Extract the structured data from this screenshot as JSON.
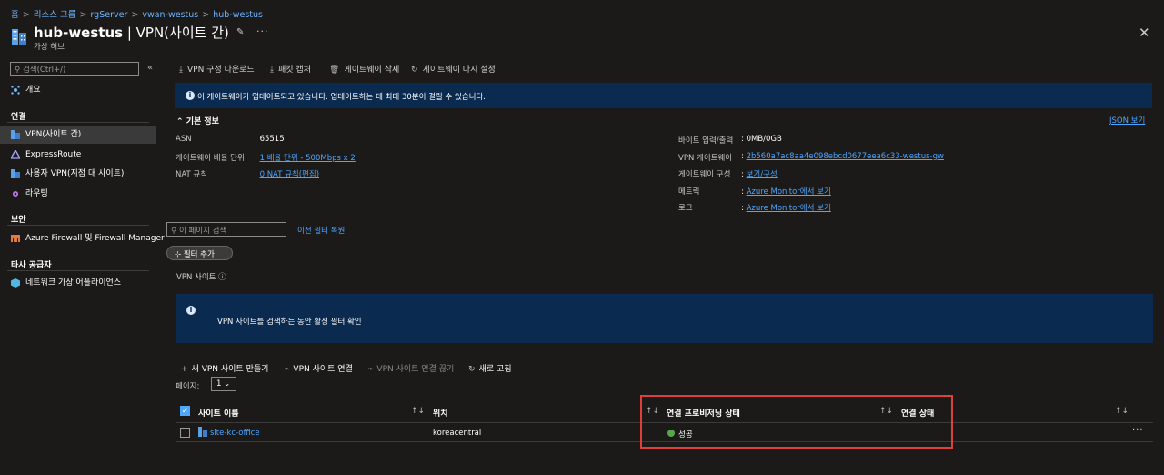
{
  "breadcrumb": [
    "홈",
    "리소스 그룹",
    "rgServer",
    "vwan-westus",
    "hub-westus"
  ],
  "header": {
    "title_name": "hub-westus",
    "title_rest": " | VPN(사이트 간)",
    "subtitle": "가상 허브"
  },
  "sidebar": {
    "search_placeholder": "검색(Ctrl+/)",
    "overview": "개요",
    "sections": [
      {
        "heading": "연결",
        "items": [
          "VPN(사이트 간)",
          "ExpressRoute",
          "사용자 VPN(지점 대 사이트)",
          "라우팅"
        ]
      },
      {
        "heading": "보안",
        "items": [
          "Azure Firewall 및 Firewall Manager"
        ]
      },
      {
        "heading": "타사 공급자",
        "items": [
          "네트워크 가상 어플라이언스"
        ]
      }
    ]
  },
  "toolbar": {
    "download": "VPN 구성 다운로드",
    "capture": "패킷 캡처",
    "delete": "게이트웨이 삭제",
    "reset": "게이트웨이 다시 설정"
  },
  "banner": "이 게이트웨이가 업데이트되고 있습니다. 업데이트하는 데 최대 30분이 걸릴 수 있습니다.",
  "essentials": {
    "title": "기본 정보",
    "json_link": "JSON 보기",
    "left": [
      {
        "key": "ASN",
        "value": "65515",
        "link": false
      },
      {
        "key": "게이트웨이 배율 단위",
        "value": "1 배율 단위 - 500Mbps x 2",
        "link": true
      },
      {
        "key": "NAT 규칙",
        "value": "0 NAT 규칙(편집)",
        "link": true
      }
    ],
    "right": [
      {
        "key": "바이트 입력/출력",
        "value": "0MB/0GB",
        "link": false
      },
      {
        "key": "VPN 게이트웨이",
        "value": "2b560a7ac8aa4e098ebcd0677eea6c33-westus-gw",
        "link": true
      },
      {
        "key": "게이트웨이 구성",
        "value": "보기/구성",
        "link": true
      },
      {
        "key": "메트릭",
        "value": "Azure Monitor에서 보기",
        "link": true
      },
      {
        "key": "로그",
        "value": "Azure Monitor에서 보기",
        "link": true
      }
    ]
  },
  "filter": {
    "search_placeholder": "이 페이지 검색",
    "restore": "이전 필터 복원",
    "add_filter": "필터 추가"
  },
  "vpn_sites_label": "VPN 사이트",
  "info_panel": "VPN 사이트를 검색하는 동안 활성 필터 확인",
  "commands": {
    "new_site": "새 VPN 사이트 만들기",
    "connect": "VPN 사이트 연결",
    "disconnect": "VPN 사이트 연결 끊기",
    "refresh": "새로 고침"
  },
  "paging": {
    "label": "페이지:",
    "value": "1"
  },
  "table": {
    "headers": [
      "사이트 이름",
      "위치",
      "연결 프로비저닝 상태",
      "연결 상태"
    ],
    "rows": [
      {
        "name": "site-kc-office",
        "location": "koreacentral",
        "provisioning": "성공",
        "status": ""
      }
    ]
  },
  "colors": {
    "accent": "#4ea6ff",
    "banner": "#0b2a4f",
    "success": "#57a64a",
    "highlight": "#e0403b"
  }
}
